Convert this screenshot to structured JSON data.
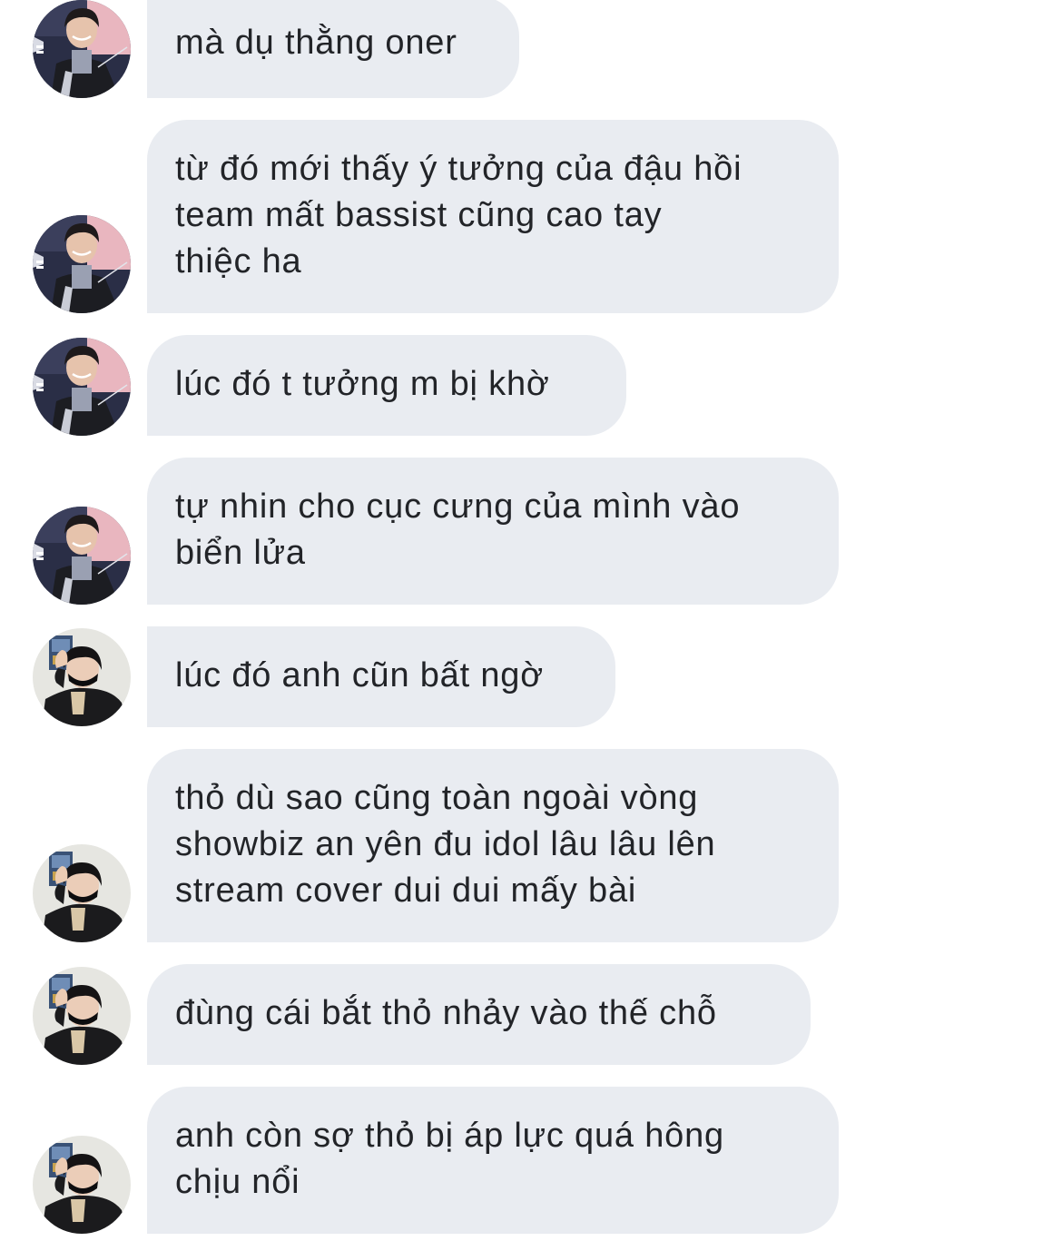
{
  "messages": [
    {
      "sender": "a",
      "text": "mà dụ thằng oner"
    },
    {
      "sender": "a",
      "text": "từ đó mới thấy ý tưởng của đậu hồi\nteam mất bassist cũng cao tay\nthiệc ha"
    },
    {
      "sender": "a",
      "text": "lúc đó t tưởng m bị khờ"
    },
    {
      "sender": "a",
      "text": "tự nhin cho cục cưng của mình vào\nbiển lửa"
    },
    {
      "sender": "b",
      "text": "lúc đó anh cũn bất ngờ"
    },
    {
      "sender": "b",
      "text": "thỏ dù sao cũng toàn ngoài vòng\nshowbiz an yên đu idol lâu lâu lên\nstream cover dui dui mấy bài"
    },
    {
      "sender": "b",
      "text": "đùng cái bắt thỏ nhảy vào thế chỗ"
    },
    {
      "sender": "b",
      "text": "anh còn sợ thỏ bị áp lực quá hông\nchịu nổi"
    }
  ],
  "colors": {
    "bubble_background": "#e9ecf1",
    "bubble_text": "#222428",
    "page_background": "#ffffff"
  }
}
